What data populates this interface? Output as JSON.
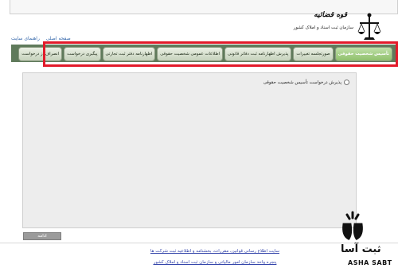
{
  "header": {
    "brand_title": "قوه قضائیه",
    "brand_subtitle": "سازمان ثبت اسناد و املاک کشور",
    "links": [
      "صفحه اصلی",
      "راهنمای سایت"
    ]
  },
  "nav": {
    "tabs": [
      {
        "label": "تأسیس شخصیت حقوقی",
        "active": true
      },
      {
        "label": "صورتجلسه تغییرات",
        "active": false
      },
      {
        "label": "پذیرش اظهارنامه ثبت دفاتر قانونی",
        "active": false
      },
      {
        "label": "اطلاعات عمومی شخصیت حقوقی",
        "active": false
      },
      {
        "label": "اظهارنامه دفتر ثبت تجارتی",
        "active": false
      },
      {
        "label": "پیگیری درخواست",
        "active": false
      },
      {
        "label": "انصراف از درخواست",
        "active": false
      }
    ],
    "highlight_color": "#e21a2a"
  },
  "main": {
    "option_label": "پذیرش درخواست تأسیس شخصیت حقوقی",
    "continue_label": "ادامه"
  },
  "footer": {
    "link_1": "سایت اطلاع رسانی قوانین، مقررات، بخشنامه و اطلاعیه ثبت شرکت ها",
    "link_2": "پنجره واحد سازمان امور مالیاتی و سازمان ثبت اسناد و املاک کشور"
  },
  "watermark": {
    "name": "ثبت آسا",
    "latin": "ASHA SABT"
  },
  "colors": {
    "nav_band": "#5f7a5b",
    "active_tab": "#8fc06c",
    "panel_bg": "#ededed",
    "link": "#3344aa"
  }
}
